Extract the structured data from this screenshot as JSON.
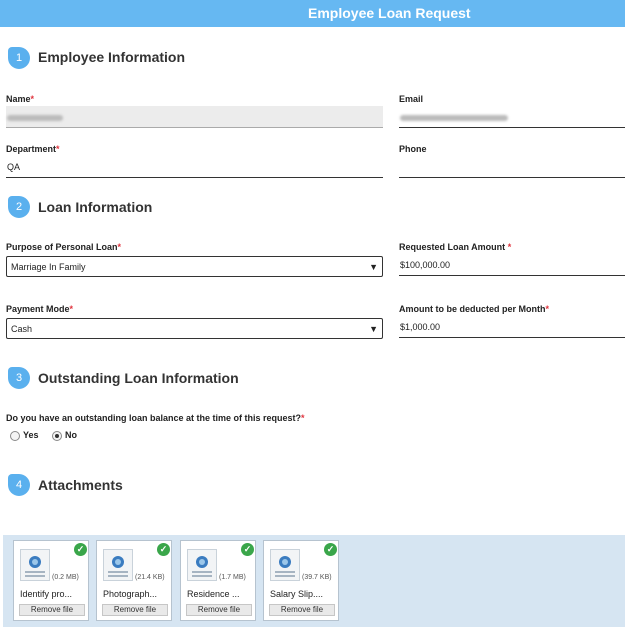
{
  "header": {
    "title": "Employee Loan Request"
  },
  "sections": [
    {
      "number": "1",
      "title": "Employee Information"
    },
    {
      "number": "2",
      "title": "Loan Information"
    },
    {
      "number": "3",
      "title": "Outstanding Loan Information"
    },
    {
      "number": "4",
      "title": "Attachments"
    }
  ],
  "employee": {
    "name_label": "Name",
    "email_label": "Email",
    "department_label": "Department",
    "department_value": "QA",
    "phone_label": "Phone",
    "phone_value": ""
  },
  "loan": {
    "purpose_label": "Purpose of Personal Loan",
    "purpose_value": "Marriage In Family",
    "amount_label": "Requested Loan Amount",
    "amount_value": "$100,000.00",
    "mode_label": "Payment Mode",
    "mode_value": "Cash",
    "deduct_label": "Amount to be deducted per Month",
    "deduct_value": "$1,000.00"
  },
  "outstanding": {
    "question": "Do you have an outstanding loan balance at the time of this request?",
    "options": [
      "Yes",
      "No"
    ],
    "selected": "No"
  },
  "required_mark": "*",
  "attachments": [
    {
      "name": "Identify pro...",
      "size": "(0.2 MB)",
      "remove": "Remove file"
    },
    {
      "name": "Photograph...",
      "size": "(21.4 KB)",
      "remove": "Remove file"
    },
    {
      "name": "Residence ...",
      "size": "(1.7 MB)",
      "remove": "Remove file"
    },
    {
      "name": "Salary Slip....",
      "size": "(39.7 KB)",
      "remove": "Remove file"
    }
  ],
  "colors": {
    "header": "#66b8f2",
    "badge": "#5ab0ee",
    "required": "#e0343e",
    "attach_bg": "#d6e5f2",
    "check": "#3aa64a"
  }
}
